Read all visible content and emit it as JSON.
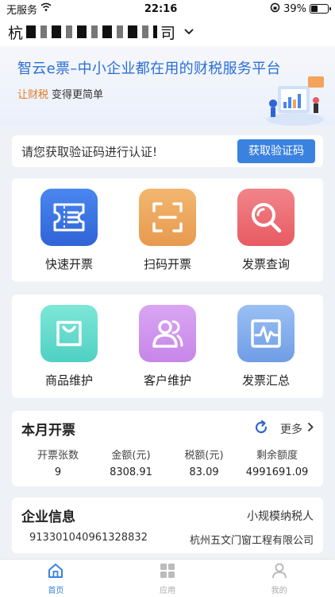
{
  "status": {
    "carrier": "无服务",
    "time": "22:16",
    "battery": "39%"
  },
  "header": {
    "company_prefix": "杭",
    "company_suffix": "司"
  },
  "banner": {
    "title": "智云e票–中小企业都在用的财税服务平台",
    "sub_highlight": "让财税",
    "sub_rest": "变得更简单"
  },
  "verify": {
    "message": "请您获取验证码进行认证!",
    "button": "获取验证码"
  },
  "grid1": [
    {
      "label": "快速开票",
      "icon": "invoice-ticket-icon"
    },
    {
      "label": "扫码开票",
      "icon": "scan-icon"
    },
    {
      "label": "发票查询",
      "icon": "search-icon"
    }
  ],
  "grid2": [
    {
      "label": "商品维护",
      "icon": "shopping-bag-icon"
    },
    {
      "label": "客户维护",
      "icon": "users-icon"
    },
    {
      "label": "发票汇总",
      "icon": "chart-icon"
    }
  ],
  "month": {
    "title": "本月开票",
    "more": "更多",
    "stats": [
      {
        "label": "开票张数",
        "value": "9"
      },
      {
        "label": "金额(元)",
        "value": "8308.91"
      },
      {
        "label": "税额(元)",
        "value": "83.09"
      },
      {
        "label": "剩余额度",
        "value": "4991691.09"
      }
    ]
  },
  "company": {
    "title": "企业信息",
    "type": "小规模纳税人",
    "tax_id": "913301040961328832",
    "name": "杭州五文门窗工程有限公司"
  },
  "tabs": [
    {
      "label": "首页",
      "active": true
    },
    {
      "label": "应用",
      "active": false
    },
    {
      "label": "我的",
      "active": false
    }
  ],
  "colors": {
    "accent": "#3b82e0",
    "highlight": "#e07a28"
  }
}
